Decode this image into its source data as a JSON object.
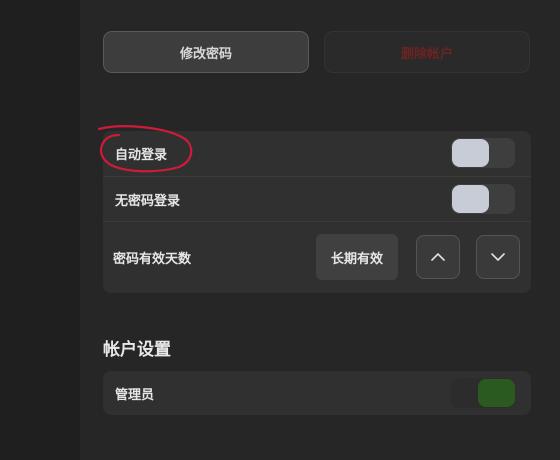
{
  "buttons": {
    "change_password": "修改密码",
    "delete_account": "删除帐户"
  },
  "login_settings": {
    "auto_login": {
      "label": "自动登录",
      "enabled": false
    },
    "passwordless_login": {
      "label": "无密码登录",
      "enabled": false
    },
    "password_validity": {
      "label": "密码有效天数",
      "value": "长期有效",
      "up_icon": "chevron-up-icon",
      "down_icon": "chevron-down-icon"
    }
  },
  "account_settings": {
    "title": "帐户设置",
    "admin": {
      "label": "管理员",
      "enabled": true
    }
  },
  "colors": {
    "background": "#262626",
    "card": "#303030",
    "toggle_knob_off": "#c8ccd6",
    "toggle_knob_on": "#2a5a20",
    "danger_text": "#6a2424",
    "annotation": "#d01a3a"
  }
}
